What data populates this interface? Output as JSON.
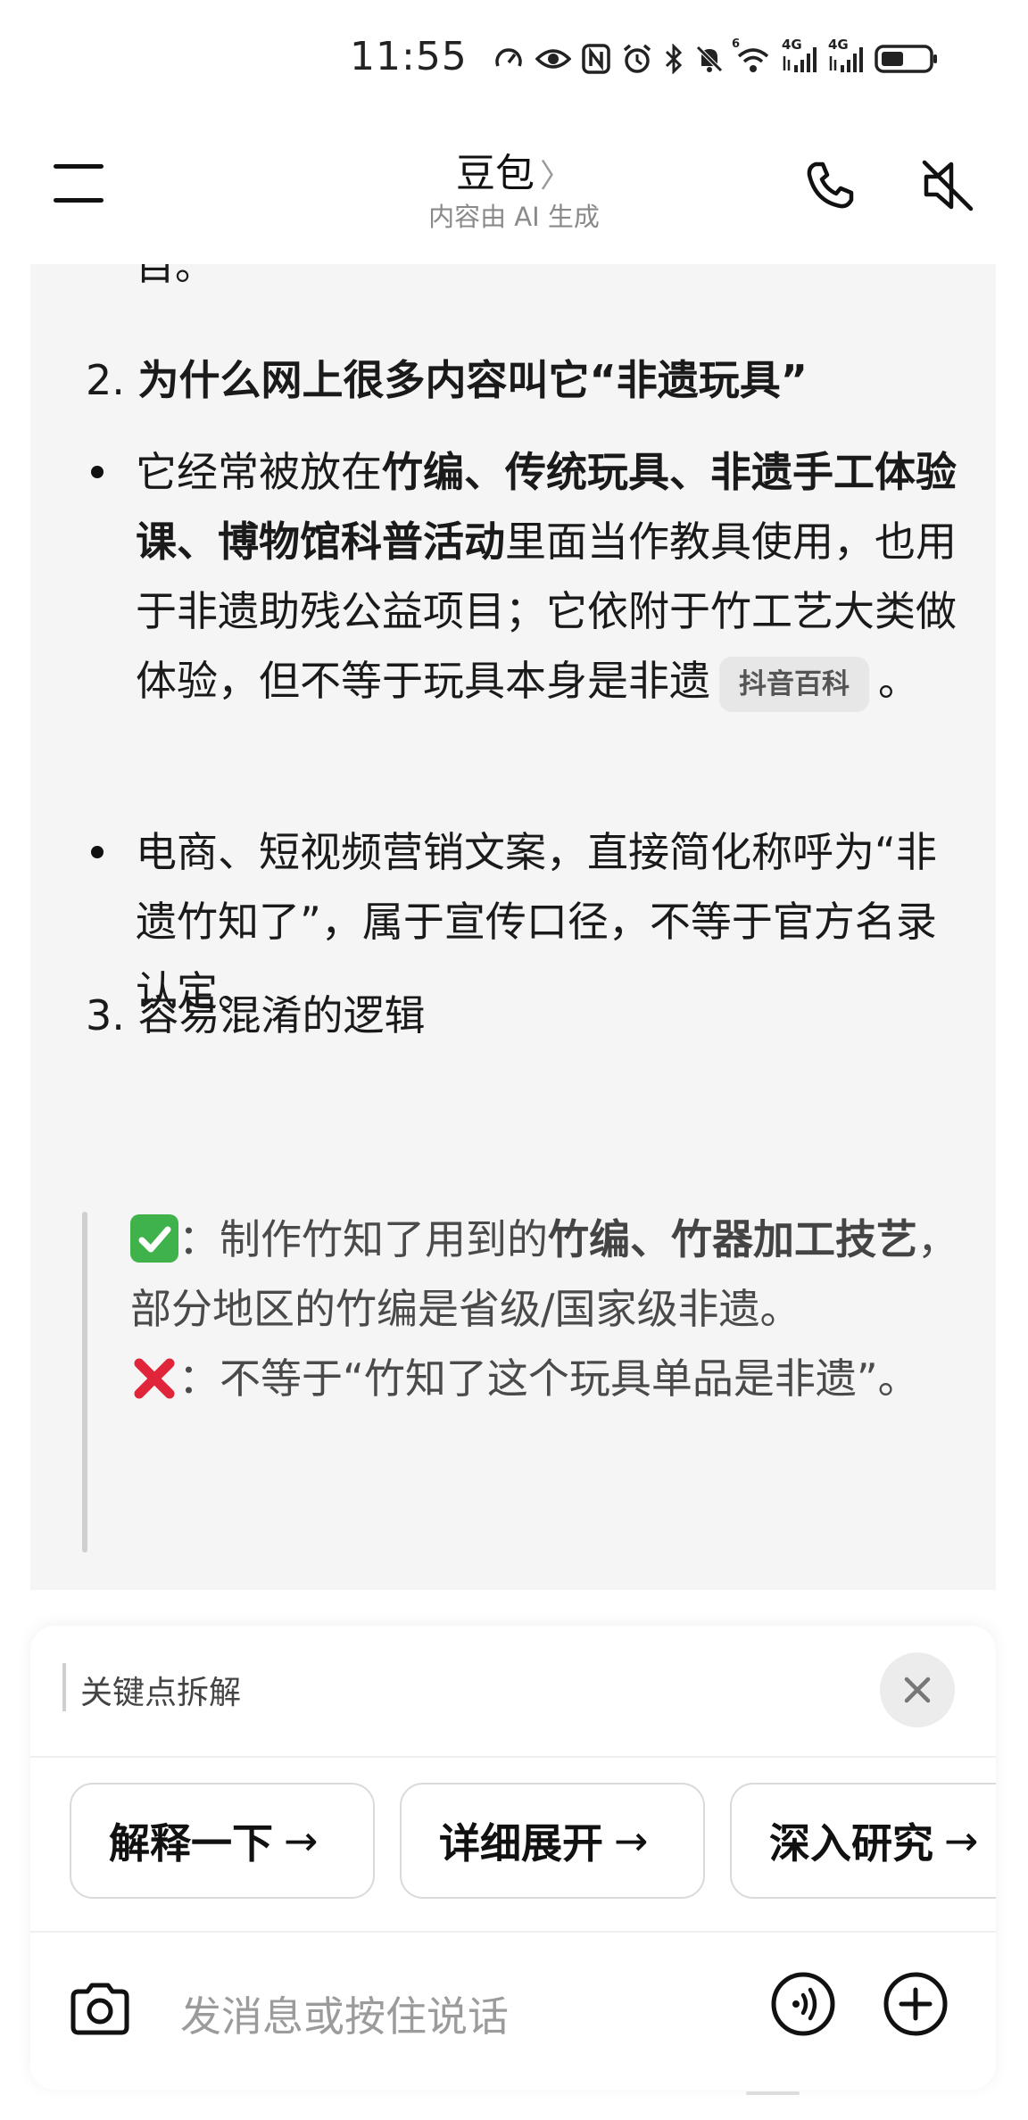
{
  "status_bar": {
    "time": "11:55",
    "net_label_1": "4G",
    "net_label_2": "4G",
    "wifi_label": "6"
  },
  "header": {
    "title": "豆包",
    "chevron": "〉",
    "subtitle": "内容由 AI 生成"
  },
  "message": {
    "cut_text": "目。",
    "item2_num": "2.",
    "item2_title": "为什么网上很多内容叫它“非遗玩具”",
    "bullet1": {
      "t1": "它经常被放在",
      "b1": "竹编、传统玩具、非遗手工体验课、博物馆科普活动",
      "t2": "里面当作教具使用，也用于非遗助残公益项目；它依附于竹工艺大类做体验，但不等于玩具本身是非遗",
      "source": "抖音百科",
      "end": "。"
    },
    "bullet2": "电商、短视频营销文案，直接简化称呼为“非遗竹知了”，属于宣传口径，不等于官方名录认定。",
    "item3_num": "3.",
    "item3_title": "容易混淆的逻辑",
    "quote": {
      "check_prefix": "：制作竹知了用到的",
      "check_bold": "竹编、竹器加工技艺",
      "check_rest": "，部分地区的竹编是省级/国家级非遗。",
      "cross_text": "：不等于“竹知了这个玩具单品是非遗”。"
    }
  },
  "panel": {
    "quoted_label": "关键点拆解",
    "suggestions": [
      {
        "label": "解释一下",
        "arrow": "→"
      },
      {
        "label": "详细展开",
        "arrow": "→"
      },
      {
        "label": "深入研究",
        "arrow": "→"
      }
    ],
    "input_placeholder": "发消息或按住说话"
  }
}
